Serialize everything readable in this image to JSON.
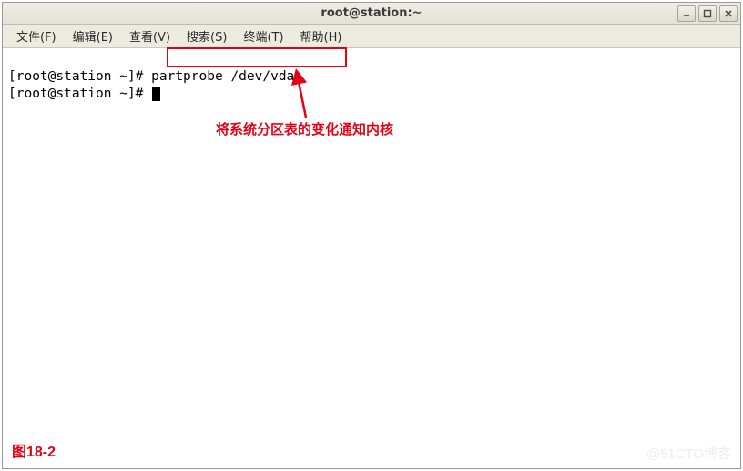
{
  "window": {
    "title": "root@station:~"
  },
  "menu": {
    "file": {
      "label": "文件(F)"
    },
    "edit": {
      "label": "编辑(E)"
    },
    "view": {
      "label": "查看(V)"
    },
    "search": {
      "label": "搜索(S)"
    },
    "term": {
      "label": "终端(T)"
    },
    "help": {
      "label": "帮助(H)"
    }
  },
  "terminal": {
    "line1_prompt": "[root@station ~]# ",
    "line1_cmd": "partprobe /dev/vda",
    "line2_prompt": "[root@station ~]# "
  },
  "annotation": {
    "text": "将系统分区表的变化通知内核"
  },
  "figure_label": "图18-2",
  "watermark": "@51CTO博客"
}
